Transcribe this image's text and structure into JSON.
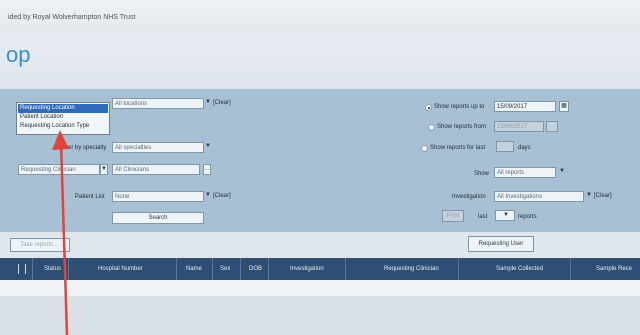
{
  "topbar": {
    "text": "ided by Royal Wolverhampton NHS Trust"
  },
  "app": {
    "title_fragment": "op"
  },
  "popup": {
    "items": [
      "Requesting Location",
      "Patient Location",
      "Requesting Location Type"
    ],
    "selected_index": 0
  },
  "filters": {
    "location_select": "All locations",
    "clear_1": "[Clear]",
    "specialty_label": "Filter by specialty",
    "specialty_select": "All specialties",
    "clinician_select": "Requesting Clinician",
    "clinician_value": "All Clinicians",
    "patient_list_label": "Patient List",
    "patient_list_value": "None",
    "clear_2": "[Clear]",
    "search_button": "Search"
  },
  "right_filters": {
    "show_up_to_label": "Show reports up to",
    "show_up_to_value": "15/09/2017",
    "show_from_label": "Show reports from",
    "show_from_value": "15/09/2017",
    "show_last_label": "Show reports for last",
    "show_last_days_label": "days",
    "show_label": "Show",
    "show_value": "All reports",
    "investigation_label": "Investigation",
    "investigation_value": "All Investigations",
    "clear_3": "[Clear]",
    "print_button": "Print",
    "last_label": "last",
    "reports_label": "reports"
  },
  "toolbar": {
    "left_button": "Take reports  ...",
    "requesting_user_button": "Requesting User"
  },
  "table": {
    "columns": [
      "Status",
      "Hospital Number",
      "Name",
      "Sex",
      "DOB",
      "Investigation",
      "Requesting Clinician",
      "Sample Collected",
      "Sample Rece"
    ]
  },
  "colors": {
    "panel": "#a7c0d3",
    "header": "#2e4e74",
    "accent": "#3a8fd0",
    "arrow": "#e0443a"
  }
}
